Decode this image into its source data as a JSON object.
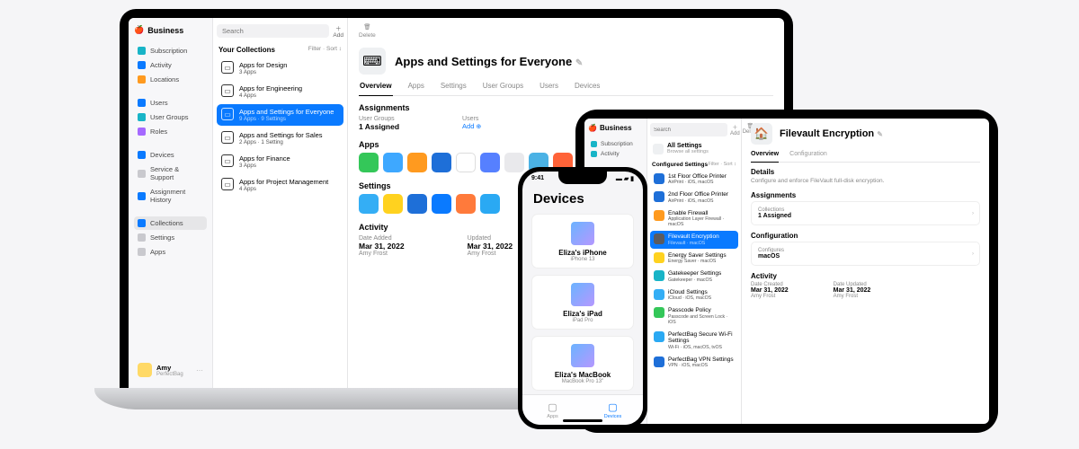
{
  "macbook": {
    "brand": "Business",
    "search_placeholder": "Search",
    "add_label": "Add",
    "delete_label": "Delete",
    "sidebar": [
      {
        "label": "Subscription",
        "icon": "star-icon"
      },
      {
        "label": "Activity",
        "icon": "clock-icon"
      },
      {
        "label": "Locations",
        "icon": "pin-icon"
      },
      {
        "label": "Users",
        "icon": "users-icon"
      },
      {
        "label": "User Groups",
        "icon": "group-icon"
      },
      {
        "label": "Roles",
        "icon": "shield-icon"
      },
      {
        "label": "Devices",
        "icon": "device-icon"
      },
      {
        "label": "Service & Support",
        "icon": "wrench-icon"
      },
      {
        "label": "Assignment History",
        "icon": "history-icon"
      },
      {
        "label": "Collections",
        "icon": "collections-icon",
        "selected": true
      },
      {
        "label": "Settings",
        "icon": "gear-icon"
      },
      {
        "label": "Apps",
        "icon": "apps-icon"
      }
    ],
    "user": {
      "name": "Amy",
      "org": "PerfectBag"
    },
    "collections_header": "Your Collections",
    "filter_label": "Filter",
    "sort_label": "Sort",
    "collections": [
      {
        "title": "Apps for Design",
        "sub": "3 Apps"
      },
      {
        "title": "Apps for Engineering",
        "sub": "4 Apps"
      },
      {
        "title": "Apps and Settings for Everyone",
        "sub": "9 Apps · 9 Settings",
        "selected": true
      },
      {
        "title": "Apps and Settings for Sales",
        "sub": "2 Apps · 1 Setting"
      },
      {
        "title": "Apps for Finance",
        "sub": "3 Apps"
      },
      {
        "title": "Apps for Project Management",
        "sub": "4 Apps"
      }
    ],
    "detail": {
      "title": "Apps and Settings for Everyone",
      "tabs": [
        "Overview",
        "Apps",
        "Settings",
        "User Groups",
        "Users",
        "Devices"
      ],
      "active_tab": 0,
      "assignments": {
        "heading": "Assignments",
        "user_groups_label": "User Groups",
        "user_groups_value": "1 Assigned",
        "users_label": "Users",
        "users_add": "Add"
      },
      "apps_heading": "Apps",
      "app_colors": [
        "#34c759",
        "#3ea8ff",
        "#ff9a1f",
        "#1e6fd8",
        "#ffffff",
        "#5680ff",
        "#e9e9ec",
        "#4bb2e5",
        "#ff6338"
      ],
      "settings_heading": "Settings",
      "setting_colors": [
        "#34aef5",
        "#ffd21f",
        "#1e6fd8",
        "#0a7aff",
        "#ff7a3b",
        "#2aa9f3"
      ],
      "activity_heading": "Activity",
      "date_added_label": "Date Added",
      "date_added_value": "Mar 31, 2022",
      "date_added_by": "Amy Frost",
      "updated_label": "Updated",
      "updated_value": "Mar 31, 2022",
      "updated_by": "Amy Frost"
    }
  },
  "iphone": {
    "time": "9:41",
    "title": "Devices",
    "devices": [
      {
        "name": "Eliza's iPhone",
        "model": "iPhone 13"
      },
      {
        "name": "Eliza's iPad",
        "model": "iPad Pro"
      },
      {
        "name": "Eliza's MacBook",
        "model": "MacBook Pro 13\""
      }
    ],
    "tabs": [
      {
        "label": "Apps",
        "icon": "apps-icon"
      },
      {
        "label": "Devices",
        "icon": "device-icon",
        "selected": true
      }
    ]
  },
  "ipad": {
    "brand": "Business",
    "search_placeholder": "Search",
    "add_label": "Add",
    "delete_label": "Delete",
    "sidebar": [
      {
        "label": "Subscription"
      },
      {
        "label": "Activity"
      }
    ],
    "all_settings_title": "All Settings",
    "all_settings_sub": "Browse all settings",
    "configured_header": "Configured Settings",
    "filter_label": "Filter",
    "sort_label": "Sort",
    "settings": [
      {
        "title": "1st Floor Office Printer",
        "sub": "AirPrint · iOS, macOS",
        "color": "#1e6fd8"
      },
      {
        "title": "2nd Floor Office Printer",
        "sub": "AirPrint · iOS, macOS",
        "color": "#1e6fd8"
      },
      {
        "title": "Enable Firewall",
        "sub": "Application Layer Firewall · macOS",
        "color": "#ff9a1f"
      },
      {
        "title": "Filevault Encryption",
        "sub": "Filevault · macOS",
        "selected": true,
        "color": "#5b5b60"
      },
      {
        "title": "Energy Saver Settings",
        "sub": "Energy Saver · macOS",
        "color": "#ffd21f"
      },
      {
        "title": "Gatekeeper Settings",
        "sub": "Gatekeeper · macOS",
        "color": "#18b4c7"
      },
      {
        "title": "iCloud Settings",
        "sub": "iCloud · iOS, macOS",
        "color": "#34aef5"
      },
      {
        "title": "Passcode Policy",
        "sub": "Passcode and Screen Lock · iOS",
        "color": "#34c759"
      },
      {
        "title": "PerfectBag Secure Wi-Fi Settings",
        "sub": "Wi-Fi · iOS, macOS, tvOS",
        "color": "#2aa9f3"
      },
      {
        "title": "PerfectBag VPN Settings",
        "sub": "VPN · iOS, macOS",
        "color": "#1e6fd8"
      }
    ],
    "detail": {
      "title": "Filevault Encryption",
      "tabs": [
        "Overview",
        "Configuration"
      ],
      "active_tab": 0,
      "details_heading": "Details",
      "details_text": "Configure and enforce FileVault full-disk encryption.",
      "assignments_heading": "Assignments",
      "collections_label": "Collections",
      "collections_value": "1 Assigned",
      "config_heading": "Configuration",
      "config_label": "Configures",
      "config_value": "macOS",
      "activity_heading": "Activity",
      "date_created_label": "Date Created",
      "date_created_value": "Mar 31, 2022",
      "date_created_by": "Amy Frost",
      "date_updated_label": "Date Updated",
      "date_updated_value": "Mar 31, 2022",
      "date_updated_by": "Amy Frost"
    }
  }
}
